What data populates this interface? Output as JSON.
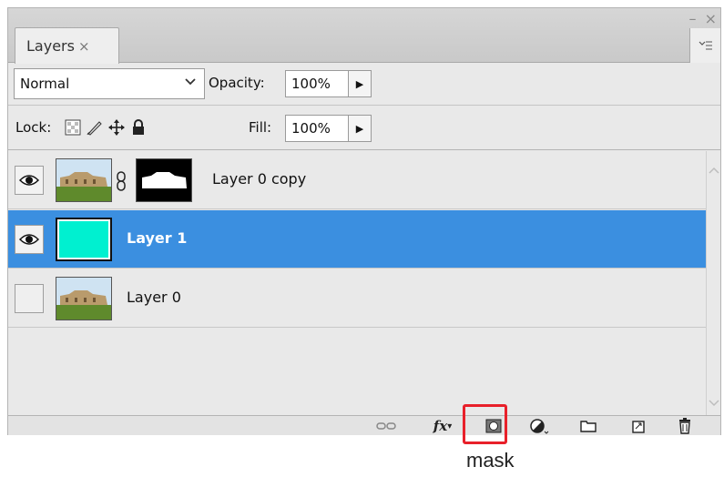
{
  "panel": {
    "tab_label": "Layers",
    "tab_close": "×",
    "window_controls": "– ×",
    "menu_icon": "panel-menu-icon"
  },
  "toolbar": {
    "blend_mode": "Normal",
    "opacity_label": "Opacity:",
    "opacity_value": "100%",
    "lock_label": "Lock:",
    "fill_label": "Fill:",
    "fill_value": "100%",
    "lock_icons": [
      "lock-transparent-icon",
      "lock-image-icon",
      "lock-position-icon",
      "lock-all-icon"
    ]
  },
  "layers": [
    {
      "name": "Layer 0 copy",
      "visible": true,
      "selected": false,
      "thumb": "photo",
      "has_mask": true
    },
    {
      "name": "Layer 1",
      "visible": true,
      "selected": true,
      "thumb_color": "#00f0d0",
      "has_mask": false
    },
    {
      "name": "Layer 0",
      "visible": false,
      "selected": false,
      "thumb": "photo",
      "has_mask": false
    }
  ],
  "bottom_bar": {
    "icons": [
      "link-layers-icon",
      "fx-icon",
      "add-mask-icon",
      "adjustment-layer-icon",
      "new-group-icon",
      "new-layer-icon",
      "delete-icon"
    ],
    "fx_text": "fx"
  },
  "annotation": {
    "label": "mask",
    "color": "#e8202a"
  },
  "colors": {
    "selection": "#3b8fe0",
    "panel_bg": "#e9e9e9"
  }
}
